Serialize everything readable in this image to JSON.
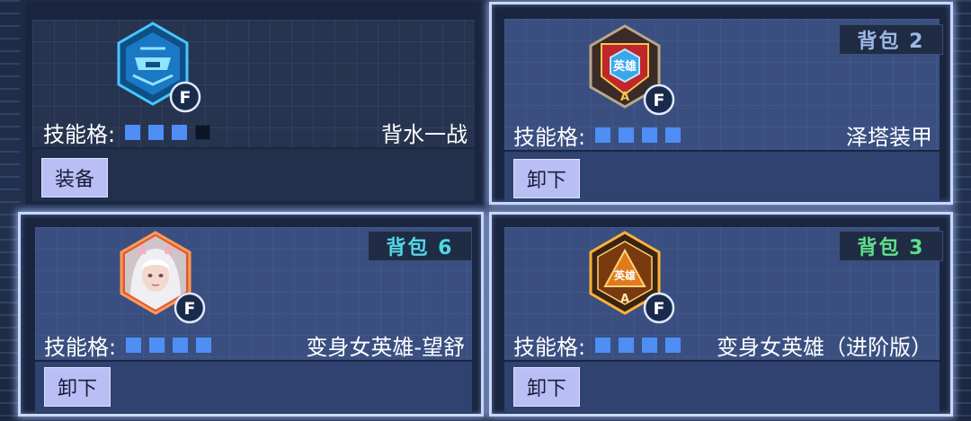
{
  "slot_label": "技能格:",
  "cards": [
    {
      "name": "背水一战",
      "slots": [
        true,
        true,
        true,
        false
      ],
      "bag": "",
      "button": "装备",
      "icon": "shield-hex-blue-icon",
      "rank_badge": "F",
      "selected": false
    },
    {
      "name": "泽塔装甲",
      "slots": [
        true,
        true,
        true,
        true
      ],
      "bag": "背包 2",
      "bag_color": "#9eb8e6",
      "button": "卸下",
      "icon": "hero-shield-red-icon",
      "icon_text": "英雄",
      "grade": "A",
      "rank_badge": "F",
      "selected": true
    },
    {
      "name": "变身女英雄-望舒",
      "slots": [
        true,
        true,
        true,
        true
      ],
      "bag": "背包 6",
      "bag_color": "#52d6e6",
      "button": "卸下",
      "icon": "heroine-portrait-icon",
      "rank_badge": "F",
      "selected": true
    },
    {
      "name": "变身女英雄（进阶版）",
      "slots": [
        true,
        true,
        true,
        true
      ],
      "bag": "背包 3",
      "bag_color": "#5ee08a",
      "button": "卸下",
      "icon": "hero-hex-gold-icon",
      "icon_text": "英雄",
      "grade": "A",
      "rank_badge": "F",
      "selected": true
    }
  ]
}
